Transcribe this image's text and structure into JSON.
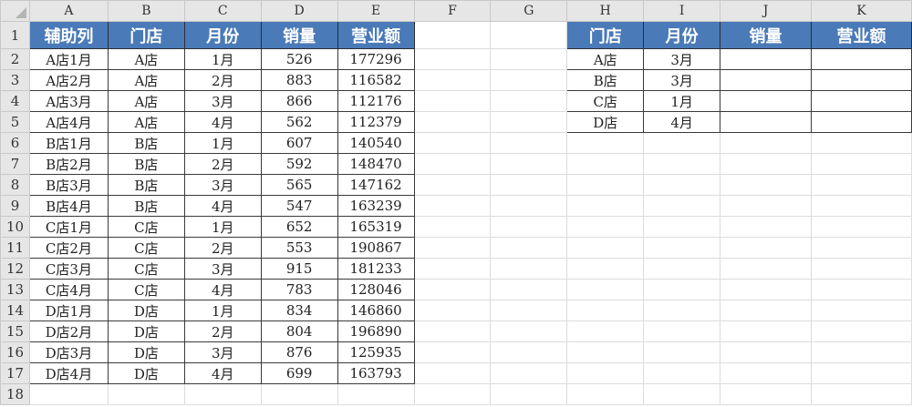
{
  "columns": [
    "A",
    "B",
    "C",
    "D",
    "E",
    "F",
    "G",
    "H",
    "I",
    "J",
    "K"
  ],
  "row_numbers": [
    "1",
    "2",
    "3",
    "4",
    "5",
    "6",
    "7",
    "8",
    "9",
    "10",
    "11",
    "12",
    "13",
    "14",
    "15",
    "16",
    "17",
    "18"
  ],
  "table1": {
    "headers": [
      "辅助列",
      "门店",
      "月份",
      "销量",
      "营业额"
    ],
    "rows": [
      [
        "A店1月",
        "A店",
        "1月",
        "526",
        "177296"
      ],
      [
        "A店2月",
        "A店",
        "2月",
        "883",
        "116582"
      ],
      [
        "A店3月",
        "A店",
        "3月",
        "866",
        "112176"
      ],
      [
        "A店4月",
        "A店",
        "4月",
        "562",
        "112379"
      ],
      [
        "B店1月",
        "B店",
        "1月",
        "607",
        "140540"
      ],
      [
        "B店2月",
        "B店",
        "2月",
        "592",
        "148470"
      ],
      [
        "B店3月",
        "B店",
        "3月",
        "565",
        "147162"
      ],
      [
        "B店4月",
        "B店",
        "4月",
        "547",
        "163239"
      ],
      [
        "C店1月",
        "C店",
        "1月",
        "652",
        "165319"
      ],
      [
        "C店2月",
        "C店",
        "2月",
        "553",
        "190867"
      ],
      [
        "C店3月",
        "C店",
        "3月",
        "915",
        "181233"
      ],
      [
        "C店4月",
        "C店",
        "4月",
        "783",
        "128046"
      ],
      [
        "D店1月",
        "D店",
        "1月",
        "834",
        "146860"
      ],
      [
        "D店2月",
        "D店",
        "2月",
        "804",
        "196890"
      ],
      [
        "D店3月",
        "D店",
        "3月",
        "876",
        "125935"
      ],
      [
        "D店4月",
        "D店",
        "4月",
        "699",
        "163793"
      ]
    ]
  },
  "table2": {
    "headers": [
      "门店",
      "月份",
      "销量",
      "营业额"
    ],
    "rows": [
      [
        "A店",
        "3月",
        "",
        ""
      ],
      [
        "B店",
        "3月",
        "",
        ""
      ],
      [
        "C店",
        "1月",
        "",
        ""
      ],
      [
        "D店",
        "4月",
        "",
        ""
      ]
    ]
  },
  "colors": {
    "header_fill": "#4a7ab8",
    "header_text": "#ffffff",
    "grid": "#dadcdf",
    "heading_bg": "#e6e6e6"
  }
}
